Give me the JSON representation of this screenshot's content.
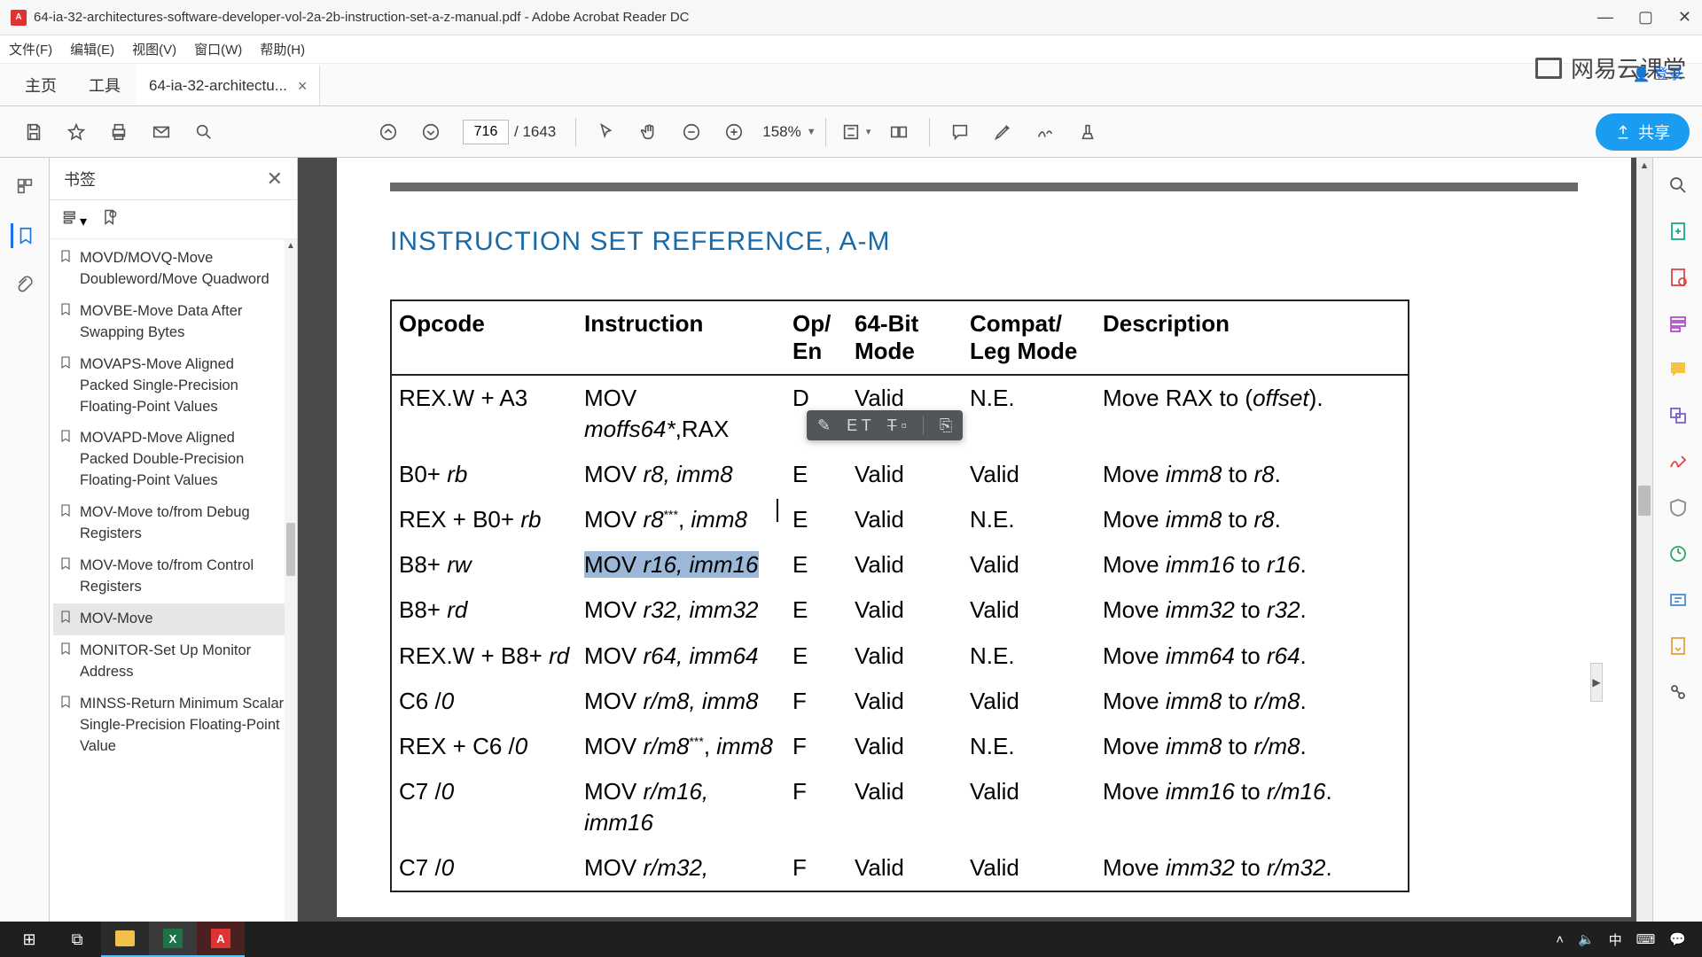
{
  "window": {
    "title": "64-ia-32-architectures-software-developer-vol-2a-2b-instruction-set-a-z-manual.pdf - Adobe Acrobat Reader DC"
  },
  "menu": {
    "file": "文件(F)",
    "edit": "编辑(E)",
    "view": "视图(V)",
    "window": "窗口(W)",
    "help": "帮助(H)"
  },
  "tabs": {
    "home": "主页",
    "tools": "工具",
    "doc": "64-ia-32-architectu...",
    "close": "×"
  },
  "brand": {
    "text": "网易云课堂"
  },
  "login": "登录",
  "toolbar": {
    "page_current": "716",
    "page_total": "/ 1643",
    "zoom": "158%",
    "share": "共享"
  },
  "bookmarks": {
    "title": "书签",
    "items": [
      {
        "label": "MINSS-Return Minimum Scalar Single-Precision Floating-Point Value",
        "active": false,
        "partial": true
      },
      {
        "label": "MONITOR-Set Up Monitor Address",
        "active": false
      },
      {
        "label": "MOV-Move",
        "active": true
      },
      {
        "label": "MOV-Move to/from Control Registers",
        "active": false
      },
      {
        "label": "MOV-Move to/from Debug Registers",
        "active": false
      },
      {
        "label": "MOVAPD-Move Aligned Packed Double-Precision Floating-Point Values",
        "active": false
      },
      {
        "label": "MOVAPS-Move Aligned Packed Single-Precision Floating-Point Values",
        "active": false
      },
      {
        "label": "MOVBE-Move Data After Swapping Bytes",
        "active": false
      },
      {
        "label": "MOVD/MOVQ-Move Doubleword/Move Quadword",
        "active": false
      }
    ]
  },
  "doc": {
    "heading": "INSTRUCTION SET REFERENCE, A-M",
    "columns": {
      "opcode": "Opcode",
      "instr": "Instruction",
      "open": "Op/\nEn",
      "mode64": "64-Bit Mode",
      "compat": "Compat/ Leg Mode",
      "desc": "Description"
    },
    "rows": [
      {
        "opcode": "REX.W + A3",
        "instr_html": "MOV <i>moffs64*</i>,RAX",
        "open": "D",
        "m64": "Valid",
        "compat": "N.E.",
        "desc_html": "Move RAX to (<i>offset</i>)."
      },
      {
        "opcode_html": "B0+ <i>rb</i>",
        "instr_html": "MOV <i>r8, imm8</i>",
        "open": "E",
        "m64": "Valid",
        "compat": "Valid",
        "desc_html": "Move <i>imm8</i> to <i>r8</i>."
      },
      {
        "opcode_html": "REX + B0+ <i>rb</i>",
        "instr_html": "MOV <i>r8</i><span class='sup'>***</span>, <i>imm8</i>",
        "open": "E",
        "m64": "Valid",
        "compat": "N.E.",
        "desc_html": "Move <i>imm8</i> to <i>r8</i>."
      },
      {
        "opcode_html": "B8+ <i>rw</i>",
        "instr_html": "<span class='hl'>MOV <i>r16, imm16</i></span>",
        "open": "E",
        "m64": "Valid",
        "compat": "Valid",
        "desc_html": "Move <i>imm16</i> to <i>r16</i>."
      },
      {
        "opcode_html": "B8+ <i>rd</i>",
        "instr_html": "MOV <i>r32, imm32</i>",
        "open": "E",
        "m64": "Valid",
        "compat": "Valid",
        "desc_html": "Move <i>imm32</i> to <i>r32</i>."
      },
      {
        "opcode_html": "REX.W + B8+ <i>rd</i>",
        "instr_html": "MOV <i>r64, imm64</i>",
        "open": "E",
        "m64": "Valid",
        "compat": "N.E.",
        "desc_html": "Move <i>imm64</i> to <i>r64</i>."
      },
      {
        "opcode_html": "C6 /<i>0</i>",
        "instr_html": "MOV <i>r/m8, imm8</i>",
        "open": "F",
        "m64": "Valid",
        "compat": "Valid",
        "desc_html": "Move <i>imm8</i> to <i>r/m8</i>."
      },
      {
        "opcode_html": "REX + C6 /<i>0</i>",
        "instr_html": "MOV <i>r/m8</i><span class='sup'>***</span>, <i>imm8</i>",
        "open": "F",
        "m64": "Valid",
        "compat": "N.E.",
        "desc_html": "Move <i>imm8</i> to <i>r/m8</i>."
      },
      {
        "opcode_html": "C7 /<i>0</i>",
        "instr_html": "MOV <i>r/m16, imm16</i>",
        "open": "F",
        "m64": "Valid",
        "compat": "Valid",
        "desc_html": "Move <i>imm16</i> to <i>r/m16</i>."
      },
      {
        "opcode_html": "C7 /<i>0</i>",
        "instr_html": "MOV <i>r/m32,</i>",
        "open": "F",
        "m64": "Valid",
        "compat": "Valid",
        "desc_html": "Move <i>imm32</i> to <i>r/m32</i>."
      }
    ]
  },
  "tray": {
    "ime": "中",
    "kbd": "⌨"
  }
}
